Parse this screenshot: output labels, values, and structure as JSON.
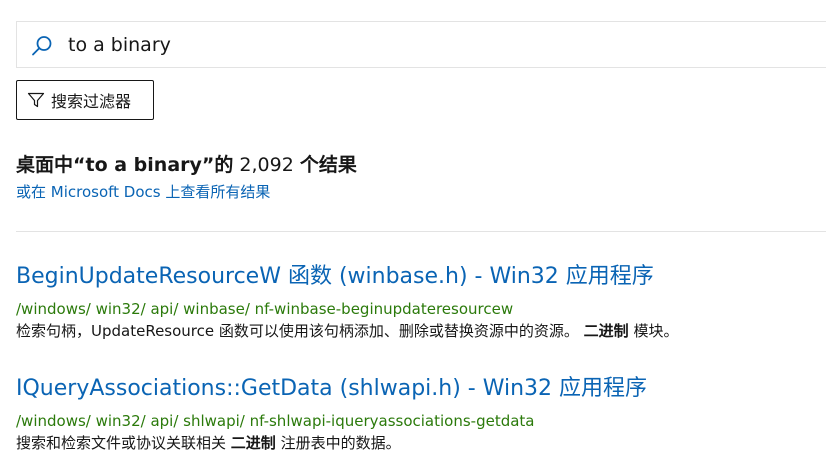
{
  "search": {
    "query": "to a binary"
  },
  "filter_button": {
    "label": "搜索过滤器"
  },
  "results_summary": {
    "prefix": "桌面中“to a binary”的",
    "count": " 2,092 ",
    "suffix": "个结果",
    "docs_link": "或在 Microsoft Docs 上查看所有结果"
  },
  "results": [
    {
      "title": "BeginUpdateResourceW 函数 (winbase.h) - Win32 应用程序",
      "path": "/windows/ win32/ api/ winbase/ nf-winbase-beginupdateresourcew",
      "desc_before": "检索句柄，UpdateResource 函数可以使用该句柄添加、删除或替换资源中的资源。 ",
      "desc_bold": "二进制",
      "desc_after": " 模块。"
    },
    {
      "title": "IQueryAssociations::GetData (shlwapi.h) - Win32 应用程序",
      "path": "/windows/ win32/ api/ shlwapi/ nf-shlwapi-iqueryassociations-getdata",
      "desc_before": "搜索和检索文件或协议关联相关 ",
      "desc_bold": "二进制",
      "desc_after": " 注册表中的数据。"
    }
  ],
  "colors": {
    "link": "#0a64b4",
    "path": "#2b7a0b",
    "text": "#171717",
    "border": "#e3e3e3"
  },
  "icons": {
    "search": "search-icon",
    "filter": "filter-icon"
  }
}
